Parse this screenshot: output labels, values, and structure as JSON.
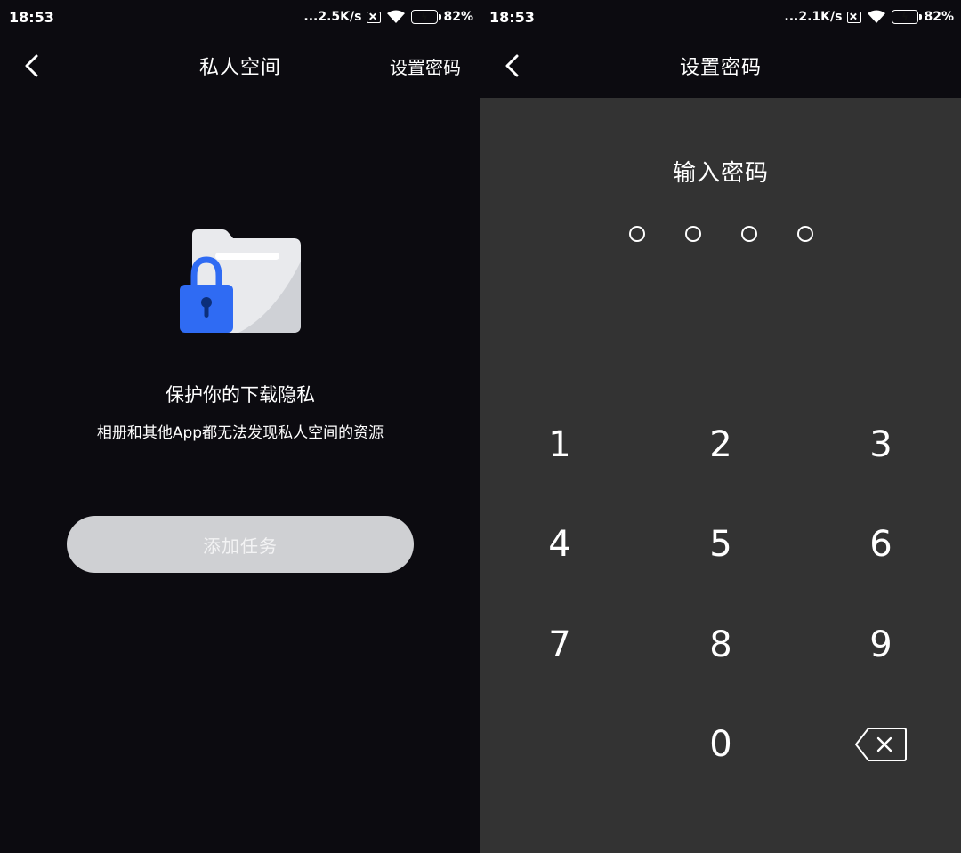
{
  "left": {
    "status": {
      "time": "18:53",
      "speed": "...2.5K/s",
      "battery": "82%"
    },
    "nav": {
      "title": "私人空间",
      "action": "设置密码"
    },
    "headline": "保护你的下载隐私",
    "subline": "相册和其他App都无法发现私人空间的资源",
    "add_button": "添加任务"
  },
  "right": {
    "status": {
      "time": "18:53",
      "speed": "...2.1K/s",
      "battery": "82%"
    },
    "nav": {
      "title": "设置密码"
    },
    "pin_title": "输入密码",
    "pin_length": 4,
    "keys": [
      "1",
      "2",
      "3",
      "4",
      "5",
      "6",
      "7",
      "8",
      "9",
      "0"
    ]
  },
  "colors": {
    "background": "#0c0b10",
    "keypad_background": "#333333",
    "button_disabled": "#cfd0d3",
    "lock_blue": "#2f6bf3",
    "battery_green": "#4cd964"
  },
  "icons": [
    "back-arrow-icon",
    "sim-off-icon",
    "wifi-icon",
    "battery-charging-icon",
    "folder-lock-icon",
    "backspace-icon"
  ]
}
